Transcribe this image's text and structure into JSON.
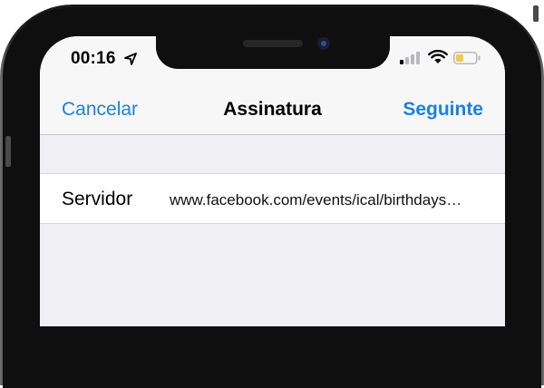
{
  "status_bar": {
    "time": "00:16",
    "icons": [
      "location-arrow-icon",
      "cellular-signal-icon",
      "wifi-icon",
      "battery-low-icon"
    ],
    "battery_color": "#f2c94c"
  },
  "nav": {
    "cancel_label": "Cancelar",
    "title": "Assinatura",
    "next_label": "Seguinte",
    "accent_color": "#1a82e2"
  },
  "form": {
    "server_label": "Servidor",
    "server_value": "www.facebook.com/events/ical/birthdays…"
  }
}
